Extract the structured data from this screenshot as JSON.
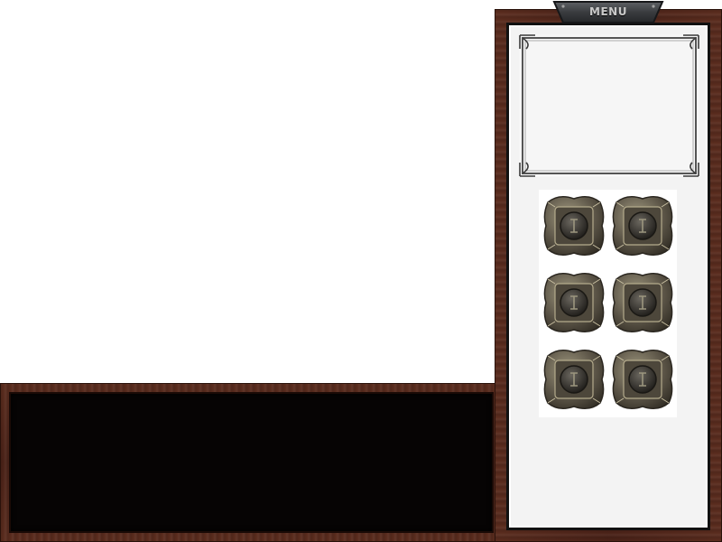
{
  "menu": {
    "tab_label": "MENU"
  },
  "slots": [
    {
      "name": "slot-1",
      "state": "empty"
    },
    {
      "name": "slot-2",
      "state": "empty"
    },
    {
      "name": "slot-3",
      "state": "empty"
    },
    {
      "name": "slot-4",
      "state": "empty"
    },
    {
      "name": "slot-5",
      "state": "empty"
    },
    {
      "name": "slot-6",
      "state": "empty"
    }
  ],
  "colors": {
    "wood": "#4a2218",
    "panel_dark": "#060404",
    "menu_bg": "#f3f3f3",
    "metal_bronze": "#6b6350"
  },
  "icons": {
    "slot_icon": "ornate-bronze-socket-icon"
  }
}
